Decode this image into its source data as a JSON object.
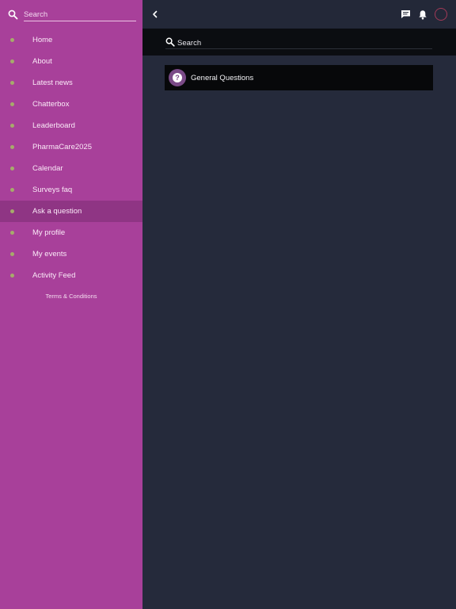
{
  "sidebar": {
    "search_placeholder": "Search",
    "items": [
      {
        "label": "Home"
      },
      {
        "label": "About"
      },
      {
        "label": "Latest news"
      },
      {
        "label": "Chatterbox"
      },
      {
        "label": "Leaderboard"
      },
      {
        "label": "PharmaCare2025"
      },
      {
        "label": "Calendar"
      },
      {
        "label": "Surveys faq"
      },
      {
        "label": "Ask a question",
        "active": true
      },
      {
        "label": "My profile"
      },
      {
        "label": "My events"
      },
      {
        "label": "Activity Feed"
      }
    ],
    "terms_link": "Terms & Conditions"
  },
  "topbar": {
    "icons": [
      "back-chevron-icon",
      "chat-icon",
      "bell-icon",
      "avatar"
    ]
  },
  "main": {
    "search_placeholder": "Search",
    "categories": [
      {
        "title": "General Questions",
        "icon": "question-mark-icon"
      }
    ]
  },
  "colors": {
    "sidebar_bg": "#a8409a",
    "sidebar_active_bg": "#8f3584",
    "main_bg": "#252a3b",
    "search_band_bg": "#0b0d11",
    "card_bg": "#07080a",
    "bullet": "#a7ab6b",
    "question_icon_bg": "#7a4a87",
    "avatar_ring": "#a23a57"
  }
}
